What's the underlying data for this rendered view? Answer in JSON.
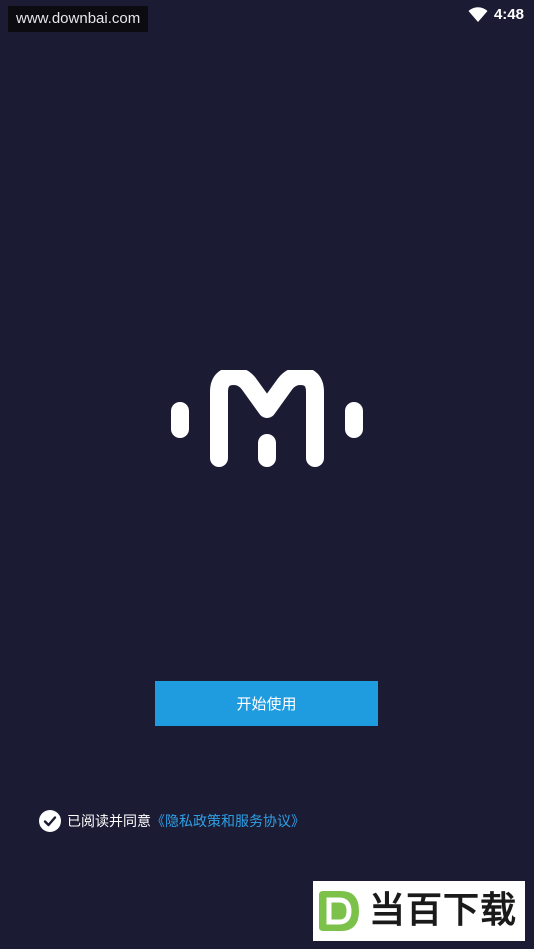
{
  "watermark_top": {
    "text": "www.downbai.com"
  },
  "status_bar": {
    "time": "4:48",
    "wifi_icon": "wifi-icon"
  },
  "logo": {
    "icon": "m-logo-icon"
  },
  "start_button": {
    "label": "开始使用",
    "color": "#1f9be0"
  },
  "agreement": {
    "check_icon": "check-circle-icon",
    "text": "已阅读并同意",
    "link": "《隐私政策和服务协议》",
    "link_color": "#2f9fe6"
  },
  "brand_badge": {
    "letter": "D",
    "text": "当百下载",
    "accent": "#7cc24a"
  },
  "theme": {
    "background": "#1b1c33"
  }
}
